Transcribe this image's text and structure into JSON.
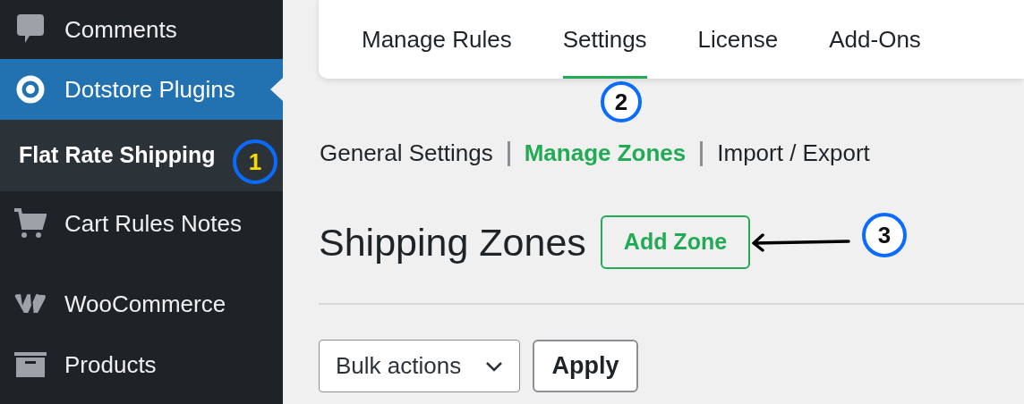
{
  "sidebar": {
    "items": [
      {
        "label": "Comments",
        "selected": false
      },
      {
        "label": "Dotstore Plugins",
        "selected": true,
        "children": [
          {
            "label": "Flat Rate Shipping",
            "selected": true
          }
        ]
      },
      {
        "label": "Cart Rules Notes",
        "selected": false
      },
      {
        "label": "WooCommerce",
        "selected": false
      },
      {
        "label": "Products",
        "selected": false
      }
    ]
  },
  "tabs": [
    {
      "label": "Manage Rules",
      "selected": false
    },
    {
      "label": "Settings",
      "selected": true
    },
    {
      "label": "License",
      "selected": false
    },
    {
      "label": "Add-Ons",
      "selected": false
    }
  ],
  "subnav": [
    {
      "label": "General Settings",
      "selected": false
    },
    {
      "label": "Manage Zones",
      "selected": true
    },
    {
      "label": "Import / Export",
      "selected": false
    }
  ],
  "heading": "Shipping Zones",
  "add_button": "Add Zone",
  "bulk_actions": {
    "value": "Bulk actions"
  },
  "apply_button": "Apply",
  "callouts": [
    {
      "number": "1",
      "color": "#f5d90a"
    },
    {
      "number": "2",
      "color": "#111111"
    },
    {
      "number": "3",
      "color": "#111111"
    }
  ]
}
